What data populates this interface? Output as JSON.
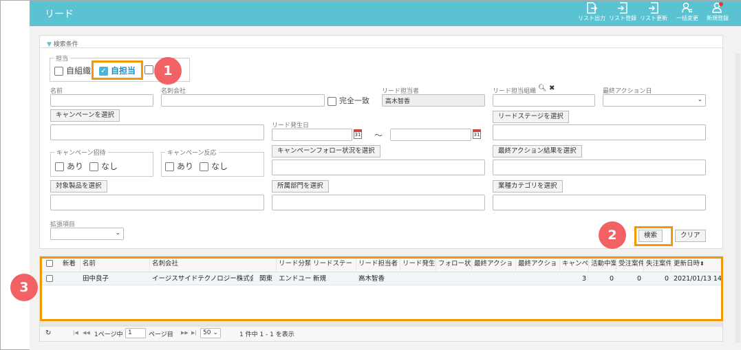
{
  "header": {
    "title": "リード",
    "buttons": [
      {
        "label": "リスト出力",
        "icon": "export-icon"
      },
      {
        "label": "リスト登録",
        "icon": "list-register-icon"
      },
      {
        "label": "リスト更新",
        "icon": "list-update-icon"
      },
      {
        "label": "一括変更",
        "icon": "bulk-change-icon"
      },
      {
        "label": "新規登録",
        "icon": "new-register-icon"
      }
    ]
  },
  "search": {
    "title": "検索条件",
    "owner_legend": "担当",
    "own_org": "自組織",
    "own_staff": "自担当",
    "name_label": "名前",
    "company_label": "名刺会社",
    "exact_match": "完全一致",
    "lead_owner_label": "リード担当者",
    "lead_owner_value": "高木智香",
    "lead_org_label": "リード担当組織",
    "last_action_date_label": "最終アクション日",
    "campaign_select": "キャンペーンを選択",
    "lead_date_label": "リード発生日",
    "tilde": "〜",
    "calendar_day": "31",
    "stage_select": "リードステージを選択",
    "invite_legend": "キャンペーン招待",
    "response_legend": "キャンペーン反応",
    "yes": "あり",
    "no": "なし",
    "campaign_follow_select": "キャンペーンフォロー状況を選択",
    "last_action_result_select": "最終アクション結果を選択",
    "product_select": "対象製品を選択",
    "department_select": "所属部門を選択",
    "industry_select": "業種カテゴリを選択",
    "extended_label": "拡張項目",
    "search_button": "検索",
    "clear_button": "クリア"
  },
  "callouts": {
    "c1": "1",
    "c2": "2",
    "c3": "3"
  },
  "table": {
    "headers": [
      "新着",
      "名前",
      "名刺会社",
      "リード分類",
      "リードステー",
      "リード担当者",
      "リード発生",
      "フォロー状",
      "最終アクショ",
      "最終アクショ",
      "キャンペ",
      "活動中案",
      "受注案件",
      "失注案件",
      "更新日時"
    ],
    "rows": [
      {
        "name": "田中良子",
        "company": "イージスサイドテクノロジー株式会社",
        "type": "関東",
        "classification": "エンドユーザ",
        "stage": "新規",
        "owner": "高木智香",
        "campaign": "3",
        "active": "0",
        "won": "0",
        "lost": "0",
        "updated": "2021/01/13 14:"
      }
    ]
  },
  "pager": {
    "refresh_icon": "refresh-icon",
    "page_prefix": "1ページ中",
    "page_value": "1",
    "page_suffix": "ページ目",
    "per_page": "50",
    "summary": "1 件中 1 - 1 を表示"
  }
}
